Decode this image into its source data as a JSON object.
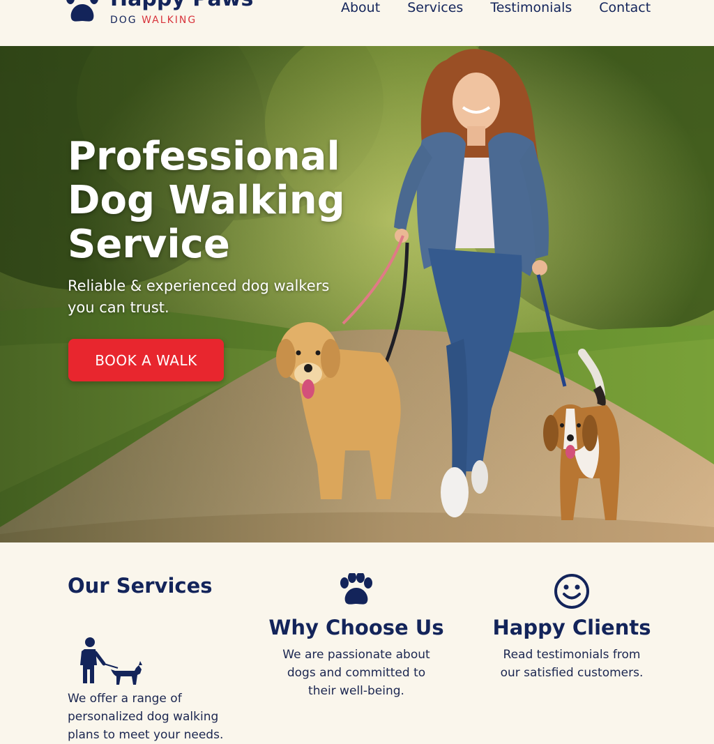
{
  "brand": {
    "name": "Happy Paws",
    "tagline_part1": "DOG ",
    "tagline_part2": "WALKING",
    "logo_icon": "paw-icon"
  },
  "nav": {
    "items": [
      {
        "label": "About"
      },
      {
        "label": "Services"
      },
      {
        "label": "Testimonials"
      },
      {
        "label": "Contact"
      }
    ]
  },
  "hero": {
    "title": "Professional Dog Walking Service",
    "subtitle": "Reliable & experienced dog walkers you can trust.",
    "cta_label": "BOOK A WALK"
  },
  "features": {
    "services": {
      "title": "Our Services",
      "text": "We offer a range of personalized dog walking plans to meet your needs.",
      "icon": "dog-walker-icon"
    },
    "why": {
      "title": "Why Choose Us",
      "text": "We are passionate about dogs and committed to their well-being.",
      "icon": "paw-icon"
    },
    "happy": {
      "title": "Happy Clients",
      "text": "Read testimonials from our satisfied customers.",
      "icon": "smiley-icon"
    }
  },
  "colors": {
    "navy": "#13245a",
    "cta_red": "#e8262e",
    "accent_red": "#d8343c",
    "cream_bg": "#faf6ec"
  }
}
